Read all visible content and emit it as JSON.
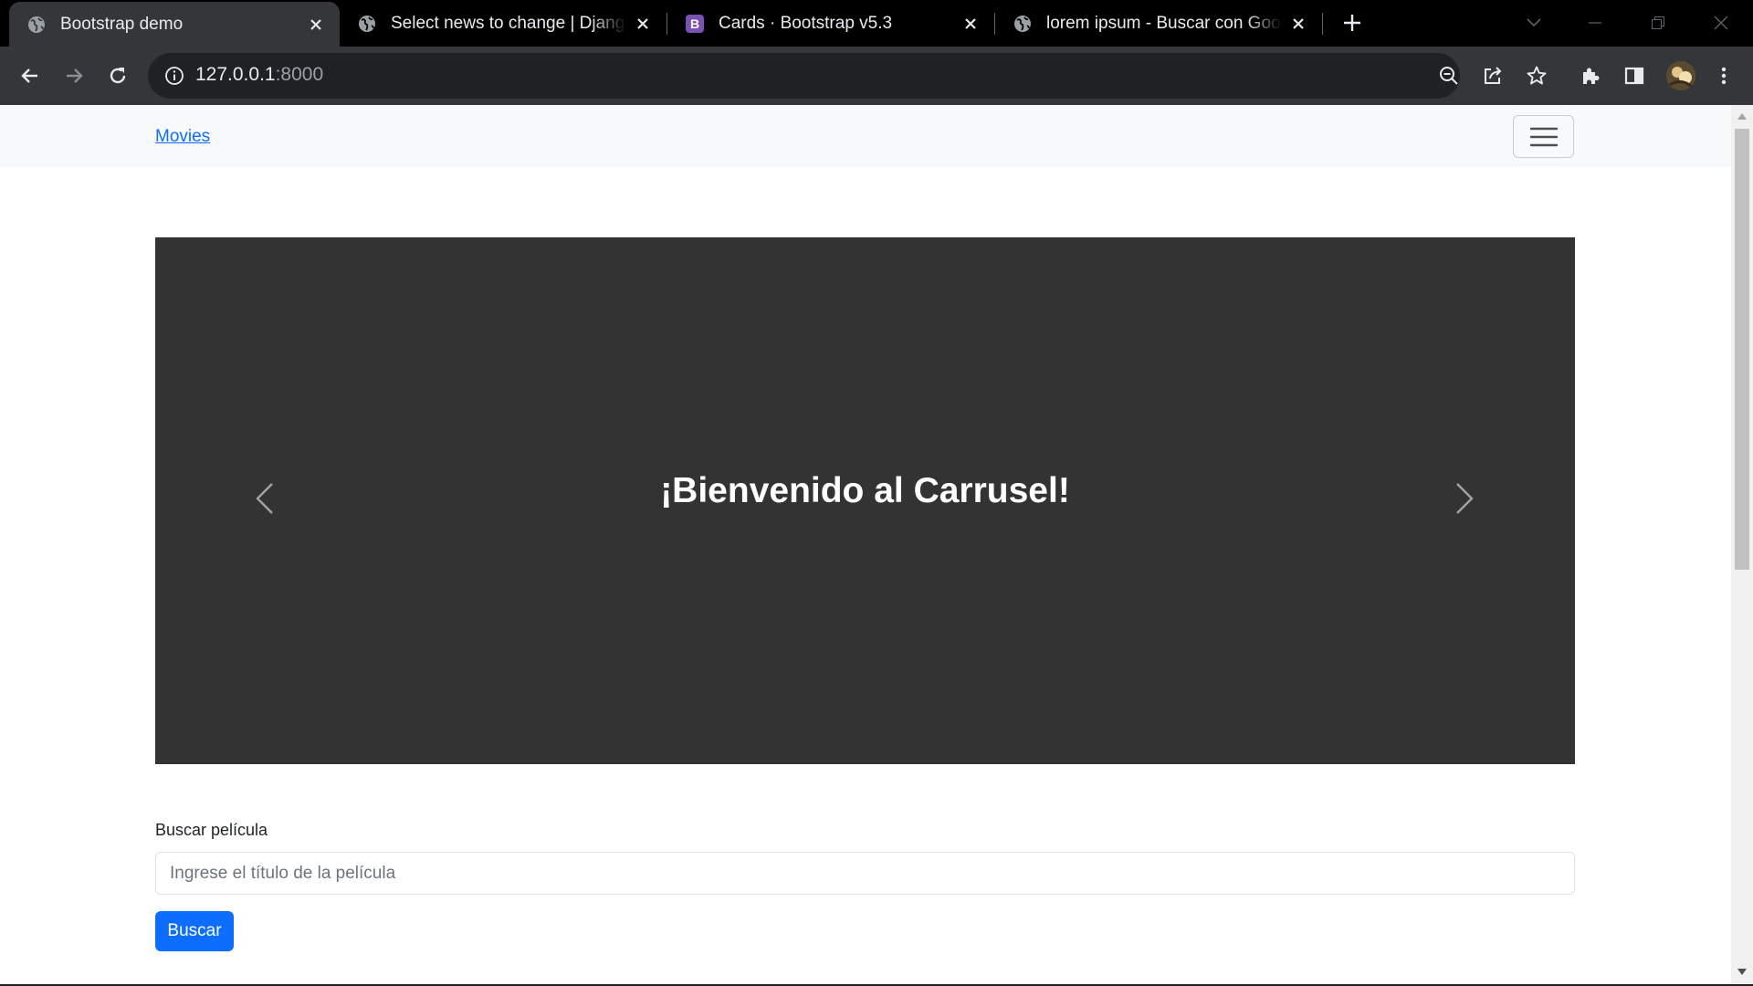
{
  "browser": {
    "tabs": [
      {
        "title": "Bootstrap demo",
        "active": true,
        "favicon": "globe-icon"
      },
      {
        "title": "Select news to change | Django site admin",
        "active": false,
        "favicon": "globe-icon"
      },
      {
        "title": "Cards · Bootstrap v5.3",
        "active": false,
        "favicon": "bootstrap-icon"
      },
      {
        "title": "lorem ipsum - Buscar con Google",
        "active": false,
        "favicon": "globe-icon"
      }
    ],
    "address": {
      "host": "127.0.0.1",
      "port": ":8000"
    },
    "colors": {
      "tab_active": "#35363a",
      "strip": "#000000",
      "omnibox": "#202124"
    }
  },
  "page": {
    "navbar": {
      "brand": "Movies",
      "toggler_icon": "hamburger-icon"
    },
    "carousel": {
      "caption": "¡Bienvenido al Carrusel!",
      "background": "#333333"
    },
    "search": {
      "label": "Buscar película",
      "placeholder": "Ingrese el título de la película",
      "button": "Buscar"
    },
    "colors": {
      "primary": "#0d6efd",
      "navbar_bg": "#f8f9fa"
    }
  }
}
